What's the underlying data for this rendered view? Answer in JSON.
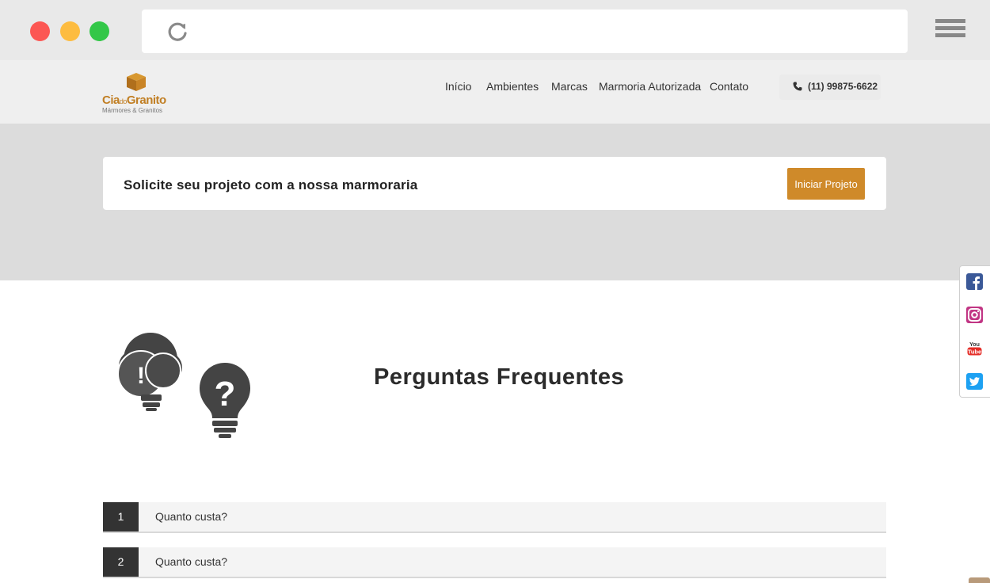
{
  "site": {
    "logo_main": "Cia",
    "logo_small": "do",
    "logo_main2": "Granito",
    "logo_sub": "Mármores & Granitos"
  },
  "nav": {
    "items": [
      "Início",
      "Ambientes",
      "Marcas",
      "Marmoria Autorizada",
      "Contato"
    ]
  },
  "phone": "(11) 99875-6622",
  "cta": {
    "text": "Solicite seu projeto com a nossa marmoraria",
    "button": "Iniciar Projeto"
  },
  "faq": {
    "title": "Perguntas Frequentes",
    "items": [
      {
        "num": "1",
        "question": "Quanto custa?"
      },
      {
        "num": "2",
        "question": "Quanto custa?"
      }
    ]
  },
  "social": [
    "facebook-icon",
    "instagram-icon",
    "youtube-icon",
    "twitter-icon"
  ],
  "colors": {
    "accent": "#cf8a2a",
    "facebook": "#3b5998",
    "instagram": "#c13584",
    "youtube": "#e52d27",
    "twitter": "#1da1f2"
  }
}
